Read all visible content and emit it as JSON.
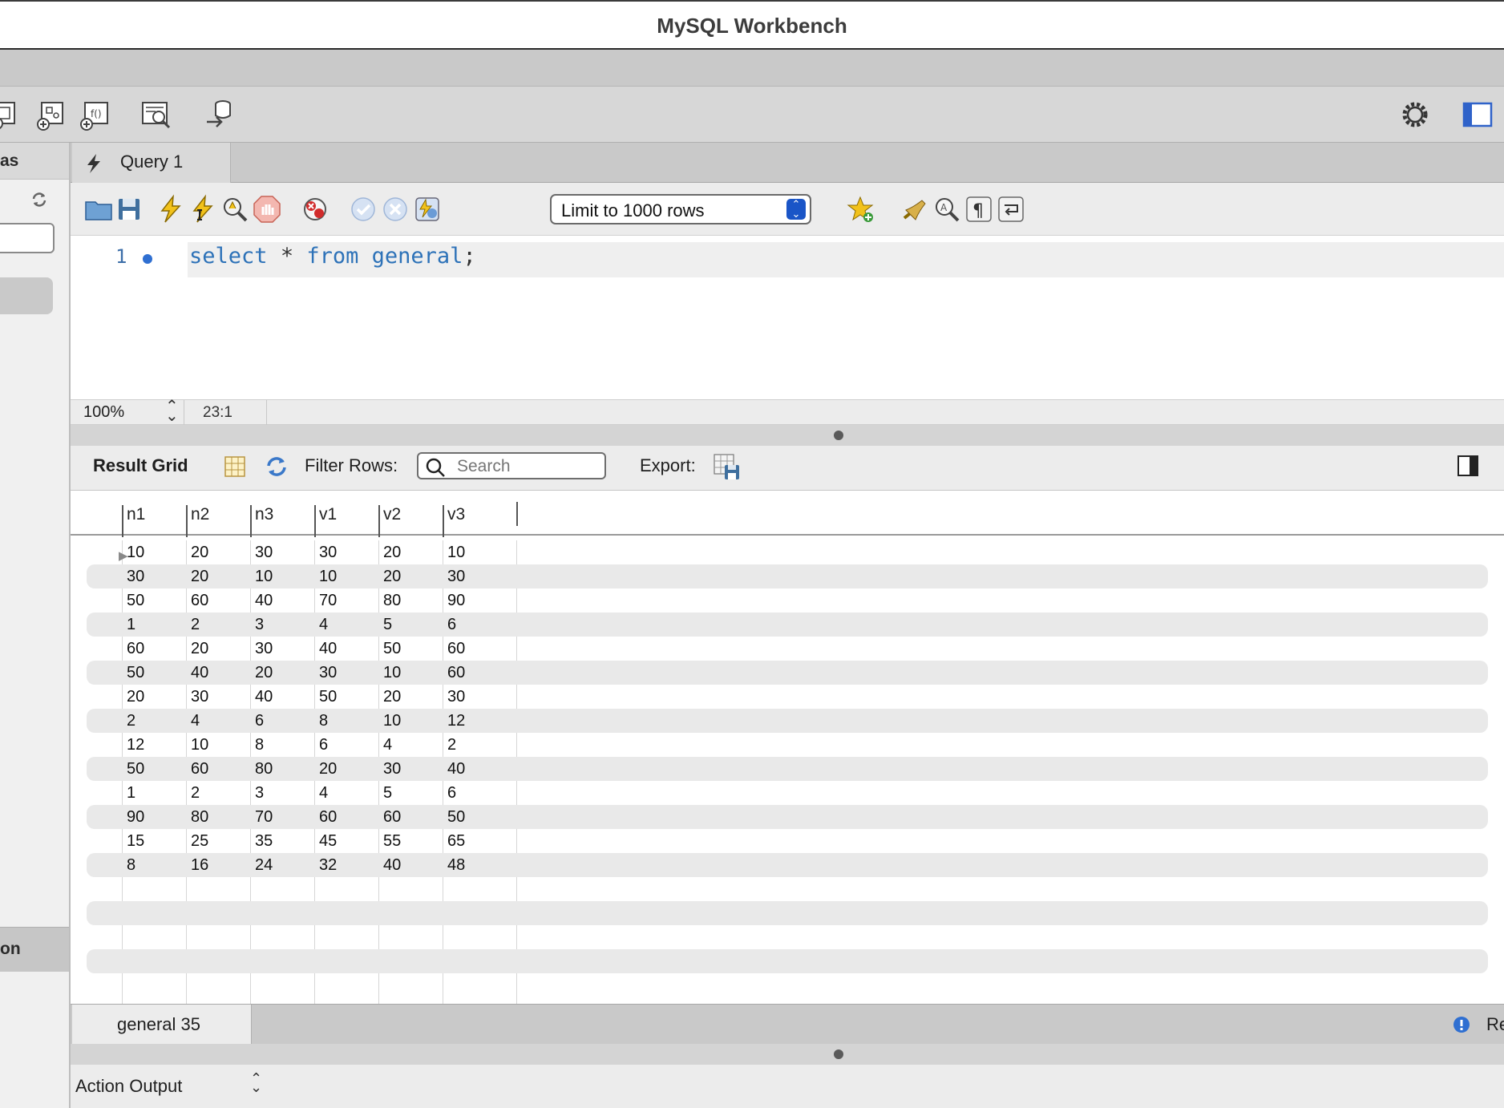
{
  "window": {
    "title": "MySQL Workbench"
  },
  "sidebar": {
    "header": "as",
    "section": "on"
  },
  "editor_tab": {
    "label": "Query 1"
  },
  "sql_toolbar": {
    "limit_select": "Limit to 1000 rows"
  },
  "editor": {
    "line_number": "1",
    "sql_keyword_select": "select",
    "sql_star": "*",
    "sql_keyword_from": "from",
    "sql_table": "general",
    "sql_semicolon": ";"
  },
  "editor_status": {
    "zoom": "100%",
    "cursor": "23:1"
  },
  "result": {
    "grid_label": "Result Grid",
    "filter_label": "Filter Rows:",
    "search_placeholder": "Search",
    "export_label": "Export:",
    "columns": [
      "n1",
      "n2",
      "n3",
      "v1",
      "v2",
      "v3"
    ],
    "rows": [
      [
        "10",
        "20",
        "30",
        "30",
        "20",
        "10"
      ],
      [
        "30",
        "20",
        "10",
        "10",
        "20",
        "30"
      ],
      [
        "50",
        "60",
        "40",
        "70",
        "80",
        "90"
      ],
      [
        "1",
        "2",
        "3",
        "4",
        "5",
        "6"
      ],
      [
        "60",
        "20",
        "30",
        "40",
        "50",
        "60"
      ],
      [
        "50",
        "40",
        "20",
        "30",
        "10",
        "60"
      ],
      [
        "20",
        "30",
        "40",
        "50",
        "20",
        "30"
      ],
      [
        "2",
        "4",
        "6",
        "8",
        "10",
        "12"
      ],
      [
        "12",
        "10",
        "8",
        "6",
        "4",
        "2"
      ],
      [
        "50",
        "60",
        "80",
        "20",
        "30",
        "40"
      ],
      [
        "1",
        "2",
        "3",
        "4",
        "5",
        "6"
      ],
      [
        "90",
        "80",
        "70",
        "60",
        "60",
        "50"
      ],
      [
        "15",
        "25",
        "35",
        "45",
        "55",
        "65"
      ],
      [
        "8",
        "16",
        "24",
        "32",
        "40",
        "48"
      ]
    ]
  },
  "result_tabs": {
    "tab_label": "general 35",
    "right_label": "Re"
  },
  "output": {
    "select_label": "Action Output"
  },
  "colors": {
    "accent": "#2d72b8",
    "stepper": "#1a55c7"
  },
  "icons": [
    "lightning-icon",
    "open-folder-icon",
    "save-icon",
    "execute-icon",
    "execute-cursor-icon",
    "explain-icon",
    "stop-icon",
    "error-toggle-icon",
    "commit-icon",
    "rollback-icon",
    "autocommit-icon",
    "bookmark-star-icon",
    "beautify-icon",
    "find-icon",
    "invisibles-icon",
    "wrap-icon",
    "gear-icon",
    "sidebar-toggle-icon",
    "grid-icon",
    "refresh-icon",
    "search-icon",
    "export-icon",
    "info-icon"
  ]
}
